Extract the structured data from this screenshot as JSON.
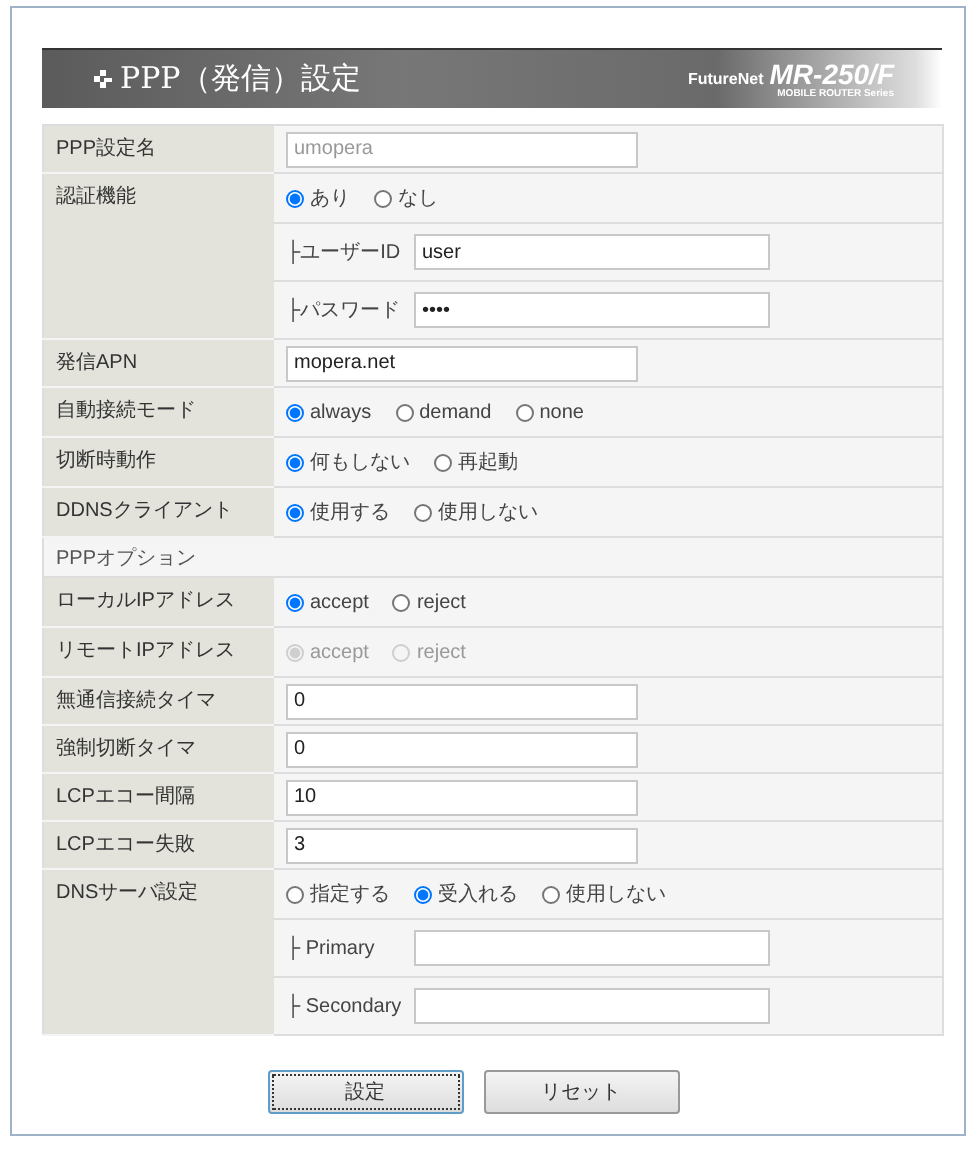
{
  "header": {
    "title": "PPP（発信）設定",
    "brand": "FutureNet",
    "model": "MR-250/F",
    "series": "MOBILE ROUTER Series"
  },
  "rows": [
    {
      "kind": "text",
      "label": "PPP設定名",
      "value": "umopera",
      "disabled": true
    },
    {
      "kind": "radio",
      "label": "認証機能",
      "disabled": false,
      "options": [
        {
          "label": "あり",
          "selected": true
        },
        {
          "label": "なし",
          "selected": false
        }
      ],
      "subs": [
        {
          "label": "├ユーザーID",
          "value": "user"
        },
        {
          "label": "├パスワード",
          "value": "••••"
        }
      ]
    },
    {
      "kind": "text",
      "label": "発信APN",
      "value": "mopera.net",
      "disabled": false
    },
    {
      "kind": "radio",
      "label": "自動接続モード",
      "disabled": false,
      "options": [
        {
          "label": "always",
          "selected": true
        },
        {
          "label": "demand",
          "selected": false
        },
        {
          "label": "none",
          "selected": false
        }
      ]
    },
    {
      "kind": "radio",
      "label": "切断時動作",
      "disabled": false,
      "options": [
        {
          "label": "何もしない",
          "selected": true
        },
        {
          "label": "再起動",
          "selected": false
        }
      ]
    },
    {
      "kind": "radio",
      "label": "DDNSクライアント",
      "disabled": false,
      "options": [
        {
          "label": "使用する",
          "selected": true
        },
        {
          "label": "使用しない",
          "selected": false
        }
      ]
    },
    {
      "kind": "section",
      "label": "PPPオプション"
    },
    {
      "kind": "radio",
      "label": "ローカルIPアドレス",
      "disabled": false,
      "options": [
        {
          "label": "accept",
          "selected": true
        },
        {
          "label": "reject",
          "selected": false
        }
      ]
    },
    {
      "kind": "radio",
      "label": "リモートIPアドレス",
      "disabled": true,
      "options": [
        {
          "label": "accept",
          "selected": true
        },
        {
          "label": "reject",
          "selected": false
        }
      ]
    },
    {
      "kind": "text",
      "label": "無通信接続タイマ",
      "value": "0",
      "disabled": false
    },
    {
      "kind": "text",
      "label": "強制切断タイマ",
      "value": "0",
      "disabled": false
    },
    {
      "kind": "text",
      "label": "LCPエコー間隔",
      "value": "10",
      "disabled": false
    },
    {
      "kind": "text",
      "label": "LCPエコー失敗",
      "value": "3",
      "disabled": false
    },
    {
      "kind": "radio",
      "label": "DNSサーバ設定",
      "disabled": false,
      "options": [
        {
          "label": "指定する",
          "selected": false
        },
        {
          "label": "受入れる",
          "selected": true
        },
        {
          "label": "使用しない",
          "selected": false
        }
      ],
      "subs": [
        {
          "label": "├ Primary"
        },
        {
          "label": "├ Secondary"
        }
      ]
    }
  ],
  "buttons": [
    {
      "label": "設定",
      "focused": true
    },
    {
      "label": "リセット",
      "focused": false
    }
  ]
}
